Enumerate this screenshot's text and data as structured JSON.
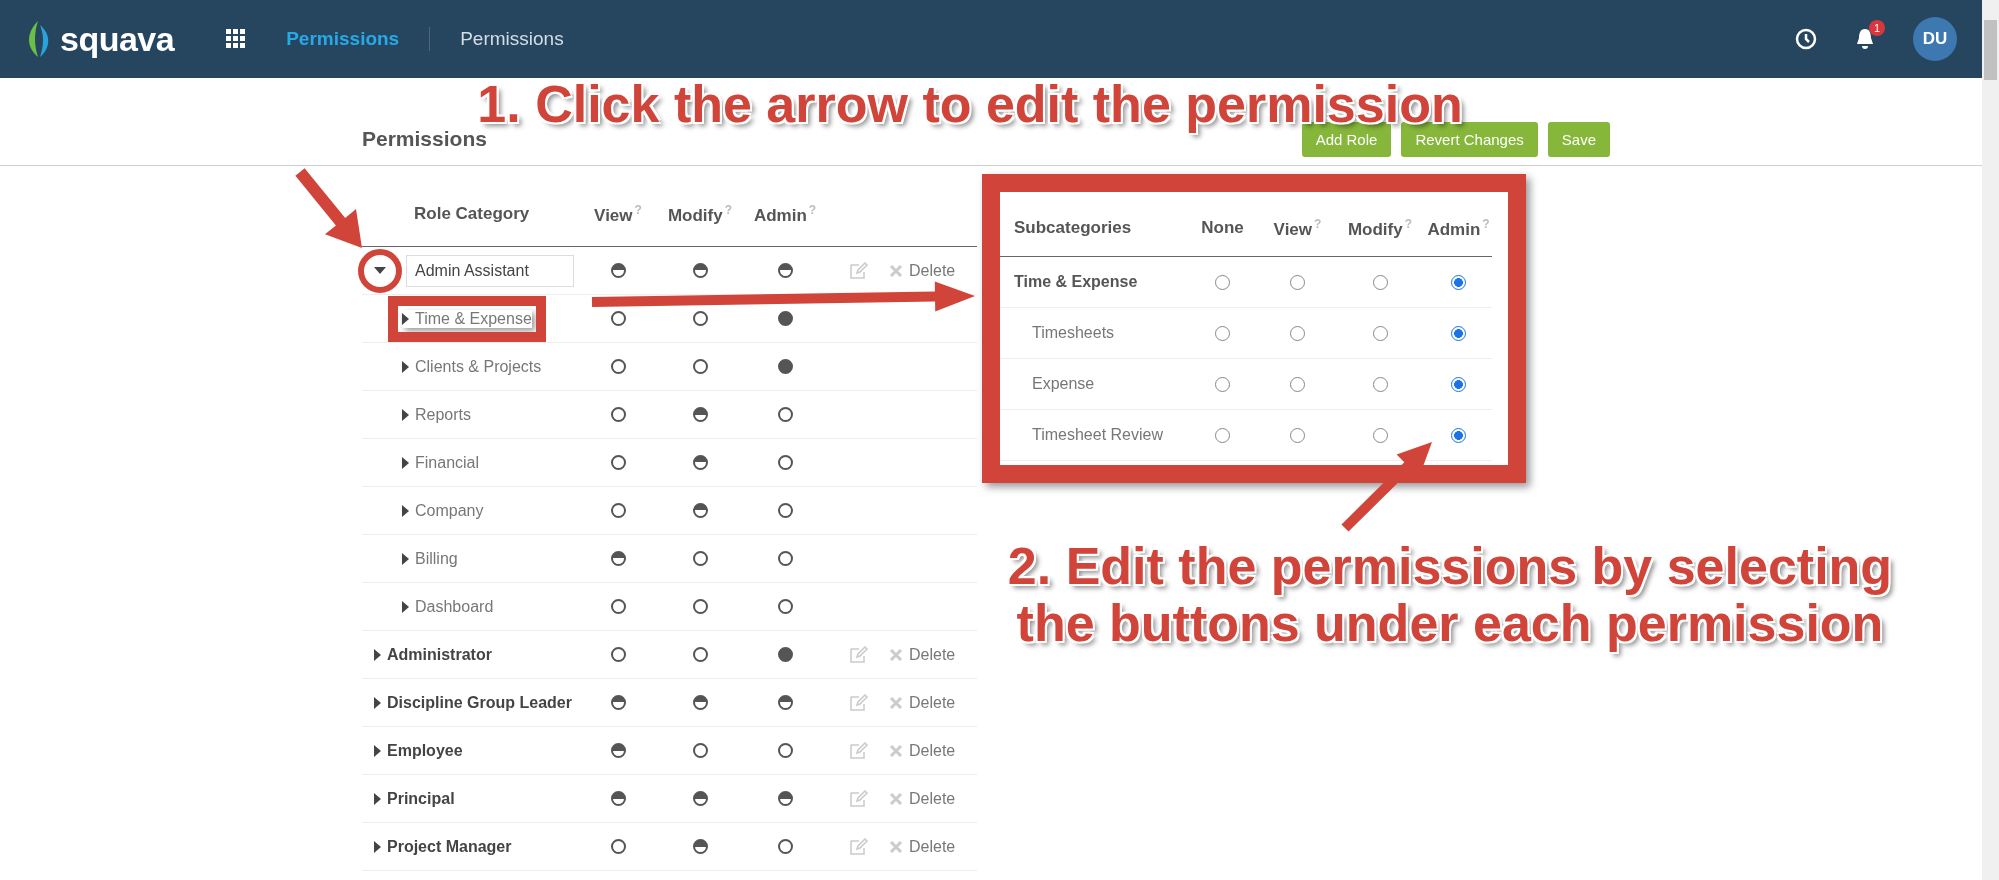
{
  "nav": {
    "brand": "squava",
    "links": [
      {
        "label": "Permissions",
        "selected": true
      },
      {
        "label": "Permissions",
        "selected": false
      }
    ],
    "notifications": "1",
    "avatar": "DU"
  },
  "page": {
    "title": "Permissions",
    "buttons": [
      "Add Role",
      "Revert Changes",
      "Save"
    ]
  },
  "roles_table": {
    "columns": [
      {
        "label": "Role Category"
      },
      {
        "label": "View",
        "hint": "?"
      },
      {
        "label": "Modify",
        "hint": "?"
      },
      {
        "label": "Admin",
        "hint": "?"
      }
    ],
    "rows": [
      {
        "name": "Admin Assistant",
        "editing": true,
        "expanded": true,
        "caret_circled": true,
        "access": [
          {
            "kind": "partial"
          },
          {
            "kind": "partial"
          },
          {
            "kind": "partial"
          }
        ],
        "delete": "Delete",
        "children": [
          {
            "name": "Time & Expense",
            "expanded": false,
            "highlighted": true,
            "access": [
              {
                "kind": "none"
              },
              {
                "kind": "none"
              },
              {
                "kind": "full"
              }
            ]
          },
          {
            "name": "Clients & Projects",
            "expanded": false,
            "highlighted": false,
            "access": [
              {
                "kind": "none"
              },
              {
                "kind": "none"
              },
              {
                "kind": "full"
              }
            ]
          },
          {
            "name": "Reports",
            "expanded": false,
            "highlighted": false,
            "access": [
              {
                "kind": "none"
              },
              {
                "kind": "partial"
              },
              {
                "kind": "none"
              }
            ]
          },
          {
            "name": "Financial",
            "expanded": false,
            "highlighted": false,
            "access": [
              {
                "kind": "none"
              },
              {
                "kind": "partial"
              },
              {
                "kind": "none"
              }
            ]
          },
          {
            "name": "Company",
            "expanded": false,
            "highlighted": false,
            "access": [
              {
                "kind": "none"
              },
              {
                "kind": "partial"
              },
              {
                "kind": "none"
              }
            ]
          },
          {
            "name": "Billing",
            "expanded": false,
            "highlighted": false,
            "access": [
              {
                "kind": "partial"
              },
              {
                "kind": "none"
              },
              {
                "kind": "none"
              }
            ]
          },
          {
            "name": "Dashboard",
            "expanded": false,
            "highlighted": false,
            "access": [
              {
                "kind": "none"
              },
              {
                "kind": "none"
              },
              {
                "kind": "none"
              }
            ]
          }
        ]
      },
      {
        "name": "Administrator",
        "editing": false,
        "expanded": false,
        "caret_circled": false,
        "access": [
          {
            "kind": "none"
          },
          {
            "kind": "none"
          },
          {
            "kind": "full"
          }
        ],
        "delete": "Delete"
      },
      {
        "name": "Discipline Group Leader",
        "editing": false,
        "expanded": false,
        "caret_circled": false,
        "access": [
          {
            "kind": "partial"
          },
          {
            "kind": "partial"
          },
          {
            "kind": "partial"
          }
        ],
        "delete": "Delete"
      },
      {
        "name": "Employee",
        "editing": false,
        "expanded": false,
        "caret_circled": false,
        "access": [
          {
            "kind": "partial"
          },
          {
            "kind": "none"
          },
          {
            "kind": "none"
          }
        ],
        "delete": "Delete"
      },
      {
        "name": "Principal",
        "editing": false,
        "expanded": false,
        "caret_circled": false,
        "access": [
          {
            "kind": "partial"
          },
          {
            "kind": "partial"
          },
          {
            "kind": "partial"
          }
        ],
        "delete": "Delete"
      },
      {
        "name": "Project Manager",
        "editing": false,
        "expanded": false,
        "caret_circled": false,
        "access": [
          {
            "kind": "none"
          },
          {
            "kind": "partial"
          },
          {
            "kind": "none"
          }
        ],
        "delete": "Delete"
      }
    ]
  },
  "subcategories": {
    "highlighted": true,
    "columns": [
      {
        "label": "Subcategories"
      },
      {
        "label": "None"
      },
      {
        "label": "View",
        "hint": "?"
      },
      {
        "label": "Modify",
        "hint": "?"
      },
      {
        "label": "Admin",
        "hint": "?"
      }
    ],
    "rows": [
      {
        "name": "Time & Expense",
        "kind": "parent",
        "options": [
          {
            "selected": false
          },
          {
            "selected": false
          },
          {
            "selected": false
          },
          {
            "selected": true
          }
        ]
      },
      {
        "name": "Timesheets",
        "kind": "child",
        "options": [
          {
            "selected": false
          },
          {
            "selected": false
          },
          {
            "selected": false
          },
          {
            "selected": true
          }
        ]
      },
      {
        "name": "Expense",
        "kind": "child",
        "options": [
          {
            "selected": false
          },
          {
            "selected": false
          },
          {
            "selected": false
          },
          {
            "selected": true
          }
        ]
      },
      {
        "name": "Timesheet Review",
        "kind": "child",
        "options": [
          {
            "selected": false
          },
          {
            "selected": false
          },
          {
            "selected": false
          },
          {
            "selected": true
          }
        ]
      }
    ]
  },
  "annotations": [
    {
      "kind": "note",
      "text": "1. Click the arrow to edit the permission"
    },
    {
      "kind": "note",
      "text": "2. Edit the permissions by selecting the buttons under each permission"
    }
  ]
}
